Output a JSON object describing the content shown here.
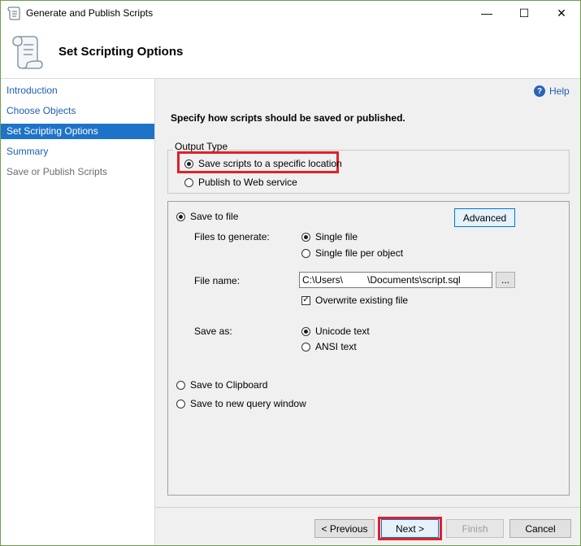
{
  "window": {
    "title": "Generate and Publish Scripts",
    "controls": {
      "minimize": "—",
      "maximize": "☐",
      "close": "✕"
    }
  },
  "header": {
    "title": "Set Scripting Options"
  },
  "nav": {
    "items": [
      {
        "label": "Introduction",
        "state": "link"
      },
      {
        "label": "Choose Objects",
        "state": "link"
      },
      {
        "label": "Set Scripting Options",
        "state": "active"
      },
      {
        "label": "Summary",
        "state": "link"
      },
      {
        "label": "Save or Publish Scripts",
        "state": "disabled"
      }
    ]
  },
  "help": {
    "label": "Help"
  },
  "instruction": "Specify how scripts should be saved or published.",
  "output_type": {
    "legend": "Output Type",
    "options": [
      {
        "label": "Save scripts to a specific location",
        "selected": true
      },
      {
        "label": "Publish to Web service",
        "selected": false
      }
    ]
  },
  "save_options": {
    "save_to_file": "Save to file",
    "advanced_button": "Advanced",
    "files_to_generate_label": "Files to generate:",
    "files_to_generate": [
      {
        "label": "Single file",
        "selected": true
      },
      {
        "label": "Single file per object",
        "selected": false
      }
    ],
    "file_name_label": "File name:",
    "file_name_value": "C:\\Users\\         \\Documents\\script.sql",
    "browse_button": "...",
    "overwrite_label": "Overwrite existing file",
    "overwrite_checked": true,
    "save_as_label": "Save as:",
    "save_as": [
      {
        "label": "Unicode text",
        "selected": true
      },
      {
        "label": "ANSI text",
        "selected": false
      }
    ],
    "save_to_clipboard": "Save to Clipboard",
    "save_to_query_window": "Save to new query window"
  },
  "footer": {
    "previous": "< Previous",
    "next": "Next >",
    "finish": "Finish",
    "cancel": "Cancel"
  },
  "colors": {
    "highlight_red": "#e0202a",
    "nav_active": "#1e73c8",
    "link_blue": "#1a5fb4"
  }
}
